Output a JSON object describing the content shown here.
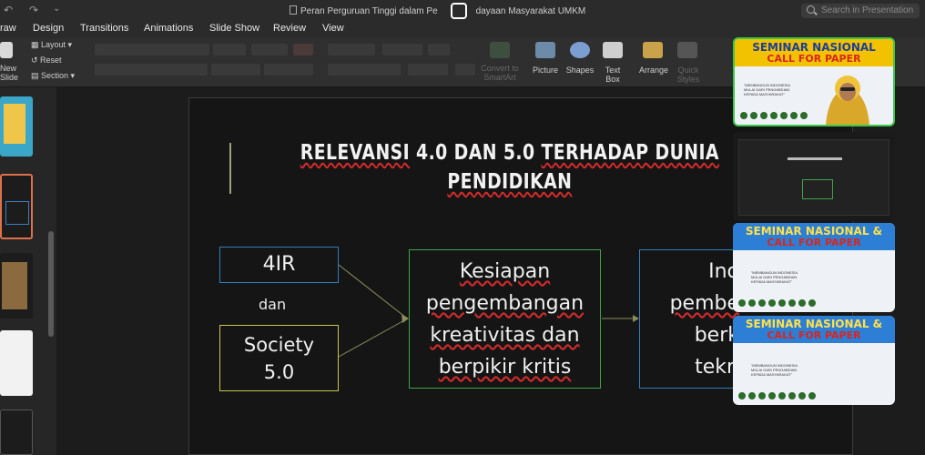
{
  "titlebar": {
    "doc_title": "Peran Perguruan Tinggi dalam Pe",
    "doc_title_tail": "dayaan Masyarakat UMKM",
    "search_placeholder": "Search in Presentation"
  },
  "tabs": [
    "raw",
    "Design",
    "Transitions",
    "Animations",
    "Slide Show",
    "Review",
    "View"
  ],
  "ribbon": {
    "new_slide": "New Slide",
    "layout": "Layout",
    "reset": "Reset",
    "section": "Section",
    "convert": "Convert to SmartArt",
    "picture": "Picture",
    "shapes": "Shapes",
    "text_box": "Text Box",
    "arrange": "Arrange",
    "quick_styles": "Quick Styles"
  },
  "slide": {
    "title_line1_a": "RELEVANSI",
    "title_line1_b": " 4.0 DAN 5.0 ",
    "title_line1_c": "TERHADAP",
    "title_line1_d": " DUNIA",
    "title_line2": "PENDIDIKAN",
    "box_4ir": "4IR",
    "dan": "dan",
    "box_society_1": "Society",
    "box_society_2": "5.0",
    "mid_line1": "Kesiapan",
    "mid_line2": "pengembangan",
    "mid_line3": "kreativitas dan",
    "mid_line4": "berpikir kritis",
    "right_line1": "Ino",
    "right_line2": "pembe",
    "right_line3": "berk",
    "right_line4": "tekn"
  },
  "video": {
    "banner_title": "SEMINAR NASIONAL",
    "banner_title_amp": "SEMINAR NASIONAL &",
    "banner_sub": "CALL FOR PAPER",
    "tagline_1": "\"MEMBANGUN INDONESIA",
    "tagline_2": "MULAI DARI PENGABDIAN",
    "tagline_3": "KEPADA MASYARAKAT\""
  }
}
